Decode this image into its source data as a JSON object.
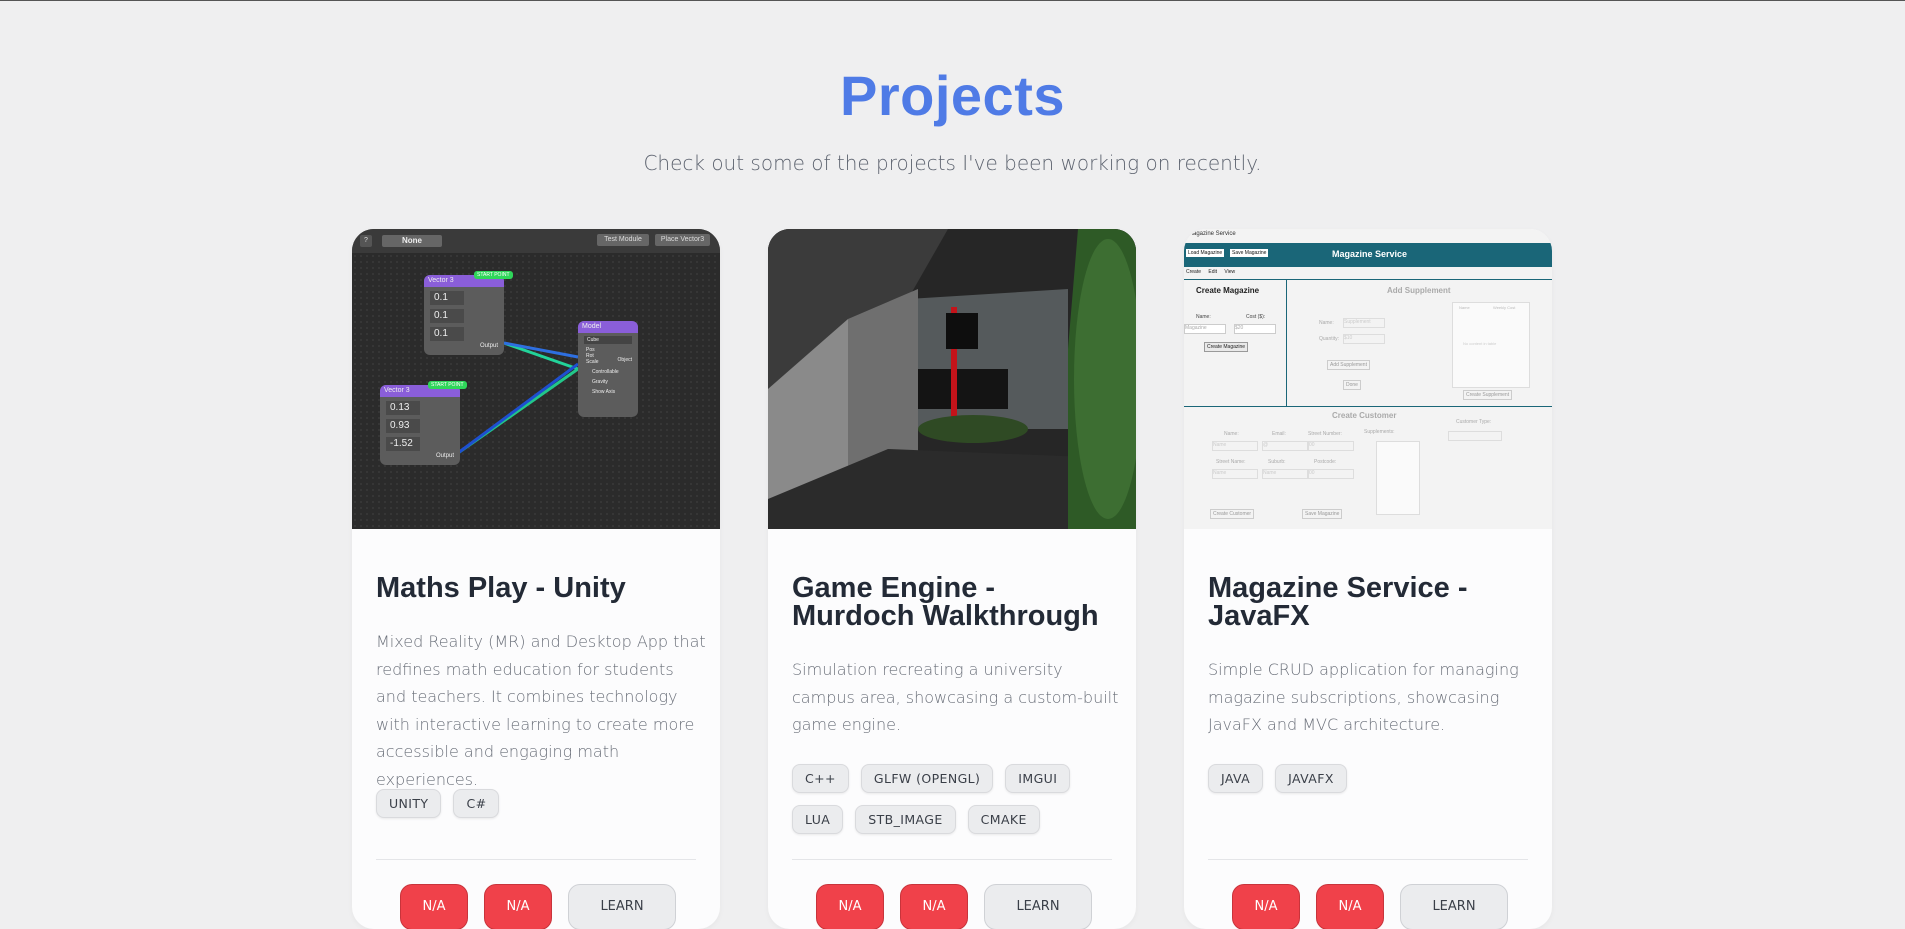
{
  "section": {
    "title": "Projects",
    "subtitle": "Check out some of the projects I've been working on recently."
  },
  "projects": [
    {
      "title": "Maths Play - Unity",
      "description": "Mixed Reality (MR) and Desktop App that redfines math education for students and teachers. It combines technology with interactive learning to create more accessible and engaging math experiences.",
      "tags": [
        "UNITY",
        "C#"
      ],
      "buttons": {
        "demo": "N/A",
        "code": "N/A",
        "learn": "LEARN"
      },
      "thumb": {
        "toolbar": {
          "help": "?",
          "dropdown": "None",
          "test": "Test Module",
          "place": "Place Vector3"
        },
        "node1": {
          "title": "Vector 3",
          "badge": "START POINT",
          "values": [
            "0.1",
            "0.1",
            "0.1"
          ],
          "axes": [
            "x",
            "y",
            "z"
          ],
          "output": "Output"
        },
        "node2": {
          "title": "Vector 3",
          "badge": "START POINT",
          "values": [
            "0.13",
            "0.93",
            "-1.52"
          ],
          "axes": [
            "x",
            "y",
            "z"
          ],
          "output": "Output"
        },
        "node3": {
          "title": "Model",
          "select": "Cube",
          "inputs": [
            "Pos",
            "Rot",
            "Scale"
          ],
          "object": "Object",
          "checks": [
            "Controllable",
            "Gravity",
            "Show Axis"
          ]
        }
      }
    },
    {
      "title": "Game Engine - Murdoch Walkthrough",
      "description": "Simulation recreating a university campus area, showcasing a custom-built game engine.",
      "tags": [
        "C++",
        "GLFW (OPENGL)",
        "IMGUI",
        "LUA",
        "STB_IMAGE",
        "CMAKE"
      ],
      "buttons": {
        "demo": "N/A",
        "code": "N/A",
        "learn": "LEARN"
      }
    },
    {
      "title": "Magazine Service - JavaFX",
      "description": "Simple CRUD application for managing magazine subscriptions, showcasing JavaFX and MVC architecture.",
      "tags": [
        "JAVA",
        "JAVAFX"
      ],
      "buttons": {
        "demo": "N/A",
        "code": "N/A",
        "learn": "LEARN"
      },
      "thumb": {
        "window_title": "Magazine Service",
        "load": "Load Magazine",
        "save": "Save Magazine",
        "header": "Magazine Service",
        "tabs": [
          "Create",
          "Edit",
          "View"
        ],
        "create_mag": "Create Magazine",
        "name_label": "Name:",
        "cost_label": "Cost ($):",
        "name_ph": "Magazine",
        "cost_ph": "$20",
        "create_mag_btn": "Create Magazine",
        "add_supp": "Add Supplement",
        "supp_name": "Name:",
        "supp_qty": "Quantity:",
        "supp_name_ph": "Supplement",
        "supp_qty_ph": "$10",
        "col_name": "Name",
        "col_cost": "Weekly Cost",
        "no_content": "No content in table",
        "add_supp_btn": "Add Supplement",
        "done": "Done",
        "create_supp": "Create Supplement",
        "create_cust": "Create Customer",
        "c_name": "Name:",
        "c_email": "Email:",
        "c_street": "Street Number:",
        "c_street_name": "Street Name:",
        "c_suburb": "Suburb:",
        "c_postcode": "Postcode:",
        "c_supps": "Supplements:",
        "c_type": "Customer Type:",
        "c_name_ph": "Name",
        "c_email_ph": "@",
        "c_num_ph": "00",
        "c_sname_ph": "Name",
        "c_sub_ph": "Name",
        "c_post_ph": "00",
        "create_cust_btn": "Create Customer",
        "save_mag": "Save Magazine"
      }
    }
  ]
}
